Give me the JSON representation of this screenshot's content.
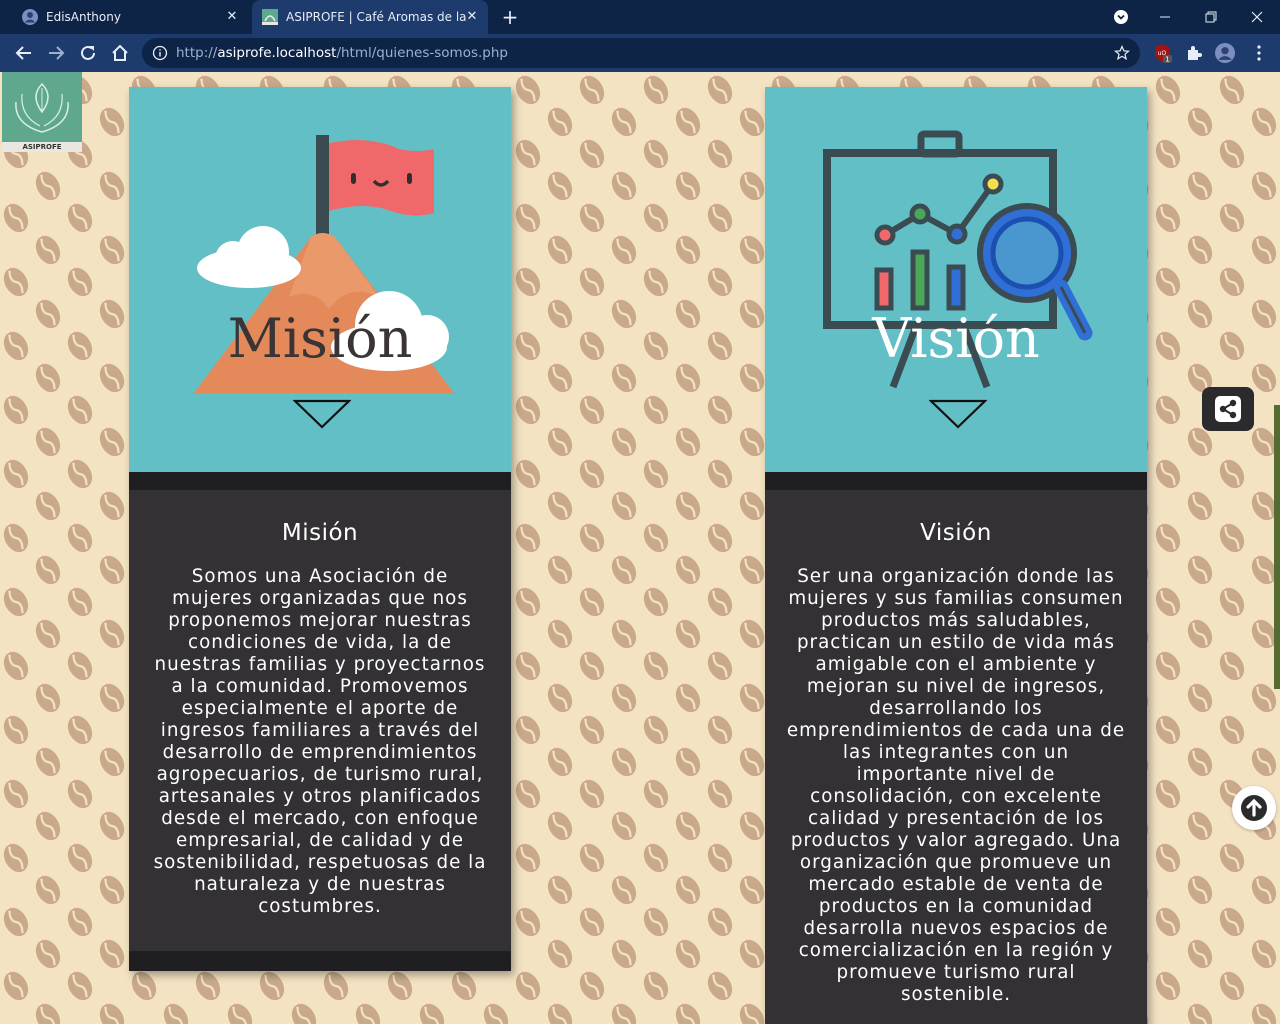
{
  "browser": {
    "tabs": [
      {
        "title": "EdisAnthony",
        "active": false
      },
      {
        "title": "ASIPROFE | Café Aromas de la Le",
        "active": true
      }
    ],
    "url": {
      "scheme": "http://",
      "host": "asiprofe.localhost",
      "path": "/html/quienes-somos.php"
    },
    "extension_badge": "1"
  },
  "logo": {
    "text": "ASIPROFE"
  },
  "mision": {
    "overlay_title": "Misión",
    "heading": "Misión",
    "text": "Somos una Asociación de mujeres organizadas que nos proponemos mejorar nuestras condiciones de vida, la de nuestras familias y proyectarnos a la comunidad. Promovemos especialmente el aporte de ingresos familiares a través del desarrollo de emprendimientos agropecuarios, de turismo rural, artesanales y otros planificados desde el mercado, con enfoque empresarial, de calidad y de sostenibilidad, respetuosas de la naturaleza y de nuestras costumbres."
  },
  "vision": {
    "overlay_title": "Visión",
    "heading": "Visión",
    "text": "Ser una organización donde las mujeres y sus familias consumen productos más saludables, practican un estilo de vida más amigable con el ambiente y mejoran su nivel de ingresos, desarrollando los emprendimientos de cada una de las integrantes con un importante nivel de consolidación, con excelente calidad y presentación de los productos y valor agregado. Una organización que promueve un mercado estable de venta de productos en la comunidad desarrolla nuevos espacios de comercialización en la región y promueve turismo rural sostenible."
  },
  "colors": {
    "background": "#f3e3c3",
    "bean": "#c9a98a",
    "card_top": "#63bfc6",
    "card_body": "#333134",
    "tab_bar": "#0d2447",
    "toolbar": "#1d3b6c"
  },
  "icons": [
    "profile-icon",
    "close-icon",
    "plus-icon",
    "back-icon",
    "forward-icon",
    "reload-icon",
    "home-icon",
    "info-icon",
    "star-icon",
    "ublock-icon",
    "puzzle-icon",
    "account-icon",
    "menu-icon",
    "share-icon",
    "arrow-up-icon",
    "down-arrow-icon",
    "mountain-flag-icon",
    "presentation-chart-icon"
  ]
}
